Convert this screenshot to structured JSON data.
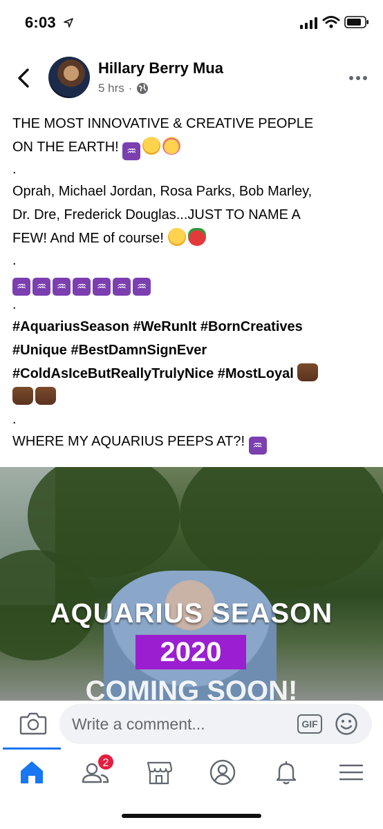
{
  "status_bar": {
    "time": "6:03"
  },
  "post": {
    "author": "Hillary Berry Mua",
    "time_ago": "5 hrs",
    "separator": "·",
    "lines": {
      "l1": "THE MOST INNOVATIVE & CREATIVE PEOPLE",
      "l2": "ON THE EARTH!",
      "l3": "Oprah, Michael Jordan, Rosa Parks, Bob Marley,",
      "l4": "Dr. Dre, Frederick Douglas...JUST TO NAME A",
      "l5": "FEW! And ME of course!",
      "dot": ".",
      "t1": "#AquariusSeason #WeRunIt #BornCreatives",
      "t2": "#Unique #BestDamnSignEver",
      "t3": "#ColdAsIceButReallyTrulyNice #MostLoyal",
      "l6": "WHERE MY AQUARIUS PEEPS AT?!"
    },
    "zodiac_glyph": "♒"
  },
  "video": {
    "title": "AQUARIUS SEASON",
    "year": "2020",
    "subtitle": "COMING SOON!"
  },
  "comment_bar": {
    "placeholder": "Write a comment...",
    "gif_label": "GIF"
  },
  "tab_bar": {
    "friends_badge": "2"
  },
  "colors": {
    "accent": "#1877f2",
    "badge": "#e41e3f",
    "zodiac": "#7b3fb0",
    "year_banner": "#9b1fd1"
  }
}
